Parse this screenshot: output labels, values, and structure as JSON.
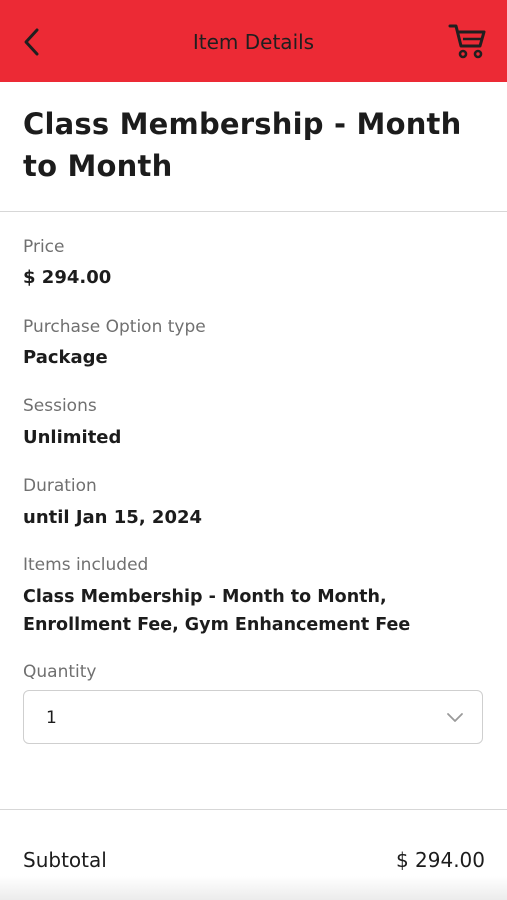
{
  "header": {
    "title": "Item Details",
    "back_icon": "chevron-left-icon",
    "cart_icon": "shopping-cart-icon",
    "color": "#ec2a35"
  },
  "item": {
    "title": "Class Membership - Month to Month"
  },
  "fields": {
    "price": {
      "label": "Price",
      "value": "$ 294.00"
    },
    "purchase_option": {
      "label": "Purchase Option type",
      "value": "Package"
    },
    "sessions": {
      "label": "Sessions",
      "value": "Unlimited"
    },
    "duration": {
      "label": "Duration",
      "value": "until Jan 15, 2024"
    },
    "items_included": {
      "label": "Items included",
      "value": "Class Membership - Month to Month, Enrollment Fee, Gym Enhancement Fee"
    }
  },
  "quantity": {
    "label": "Quantity",
    "selected": "1",
    "icon": "chevron-down-icon"
  },
  "summary": {
    "subtotal_label": "Subtotal",
    "subtotal_value": "$ 294.00"
  }
}
